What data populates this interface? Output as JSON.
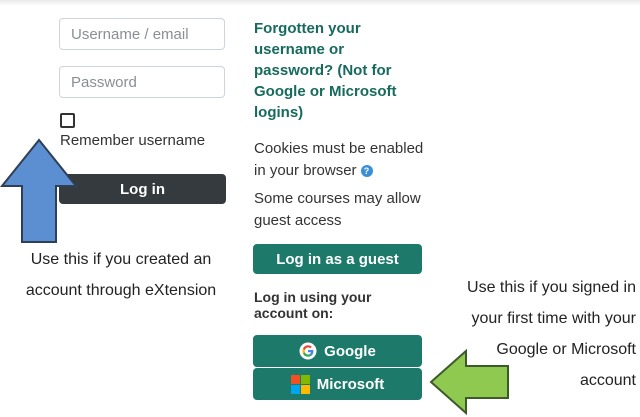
{
  "login_form": {
    "username_placeholder": "Username / email",
    "password_placeholder": "Password",
    "remember_label": "Remember username",
    "remember_checked": false,
    "login_button": "Log in"
  },
  "help": {
    "forgotten_link": "Forgotten your username or password? (Not for Google or Microsoft logins)",
    "cookies_note": "Cookies must be enabled in your browser",
    "guest_note": "Some courses may allow guest access",
    "guest_button": "Log in as a guest"
  },
  "oauth": {
    "heading": "Log in using your account on:",
    "google_button": "Google",
    "microsoft_button": "Microsoft"
  },
  "annotations": {
    "left_caption": "Use this if you created an account through eXtension",
    "right_caption": "Use this if you signed in your first time with your Google or Microsoft account"
  },
  "colors": {
    "left_arrow": "#5b8fd1",
    "right_arrow": "#8fc94f",
    "primary_teal": "#1d7a6a",
    "link_teal": "#176a5e",
    "dark_button": "#343a3e"
  }
}
